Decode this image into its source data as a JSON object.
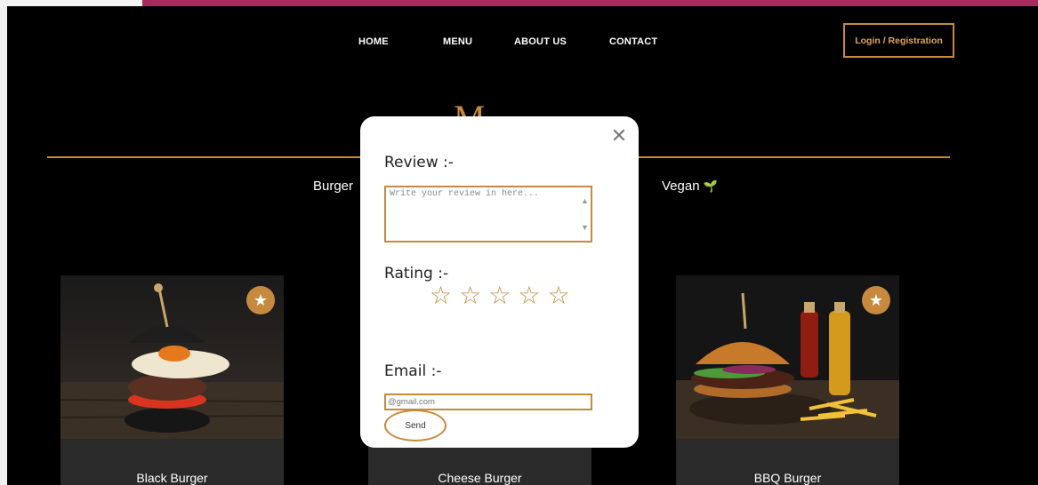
{
  "nav": {
    "items": [
      {
        "label": "HOME"
      },
      {
        "label": "MENU"
      },
      {
        "label": "ABOUT US"
      },
      {
        "label": "CONTACT"
      }
    ],
    "login_label": "Login / Registration"
  },
  "logo": {
    "letter": "M"
  },
  "categories": [
    {
      "label": "Burger"
    },
    {
      "label": "Vegan"
    }
  ],
  "cards": [
    {
      "name": "Black Burger"
    },
    {
      "name": "Cheese Burger"
    },
    {
      "name": "BBQ Burger"
    }
  ],
  "modal": {
    "review_label": "Review :-",
    "review_placeholder": "Write your review in here...",
    "rating_label": "Rating :-",
    "rating_value": 0,
    "rating_max": 5,
    "email_label": "Email :-",
    "email_placeholder": "@gmail.com",
    "send_label": "Send"
  },
  "colors": {
    "accent": "#c68a3e",
    "background": "#000000",
    "card": "#2a2a2a",
    "top_strip": "#a8285f"
  },
  "icons": {
    "close": "close-icon",
    "star": "star-outline-icon",
    "favorite": "star-badge-icon",
    "leaf": "leaf-icon"
  }
}
